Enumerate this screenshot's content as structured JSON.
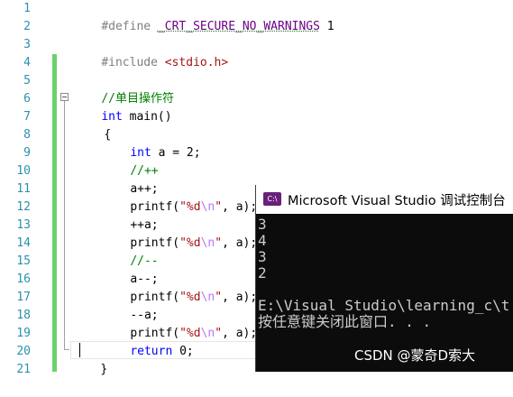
{
  "editor": {
    "line_numbers": [
      "1",
      "2",
      "3",
      "4",
      "5",
      "6",
      "7",
      "8",
      "9",
      "10",
      "11",
      "12",
      "13",
      "14",
      "15",
      "16",
      "17",
      "18",
      "19",
      "20",
      "21"
    ],
    "lines": {
      "l1_directive": "#define ",
      "l1_macro": "_CRT_SECURE_NO_WARNINGS",
      "l1_value": " 1",
      "l3_directive": "#include ",
      "l3_header": "<stdio.h>",
      "l5_comment": "//单目操作符",
      "l6_kw": "int",
      "l6_rest": " main()",
      "l7": "{",
      "l8_kw": "int",
      "l8_rest": " a = 2;",
      "l9_comment": "//++",
      "l10": "a++;",
      "l11_a": "printf(",
      "l11_s1": "\"%d",
      "l11_esc": "\\n",
      "l11_s2": "\"",
      "l11_b": ", a);",
      "l12": "++a;",
      "l13_a": "printf(",
      "l13_s1": "\"%d",
      "l13_esc": "\\n",
      "l13_s2": "\"",
      "l13_b": ", a);",
      "l14_comment": "//--",
      "l15": "a--;",
      "l16_a": "printf(",
      "l16_s1": "\"%d",
      "l16_esc": "\\n",
      "l16_s2": "\"",
      "l16_b": ", a);",
      "l17": "--a;",
      "l18_a": "printf(",
      "l18_s1": "\"%d",
      "l18_esc": "\\n",
      "l18_s2": "\"",
      "l18_b": ", a);",
      "l19_kw": "return",
      "l19_rest": " 0;",
      "l20": "}"
    }
  },
  "console": {
    "icon_label": "C:\\",
    "title": "Microsoft Visual Studio 调试控制台",
    "output": [
      "3",
      "4",
      "3",
      "2",
      "",
      "E:\\Visual Studio\\learning_c\\t",
      "按任意键关闭此窗口. . ."
    ]
  },
  "watermark": "CSDN @蒙奇D索大",
  "colors": {
    "keyword": "#0000ff",
    "comment": "#008000",
    "string": "#a31515",
    "macro": "#6f008a",
    "line_number": "#2b91af",
    "console_bg": "#0c0c0c",
    "change_bar": "#6ad36a"
  }
}
